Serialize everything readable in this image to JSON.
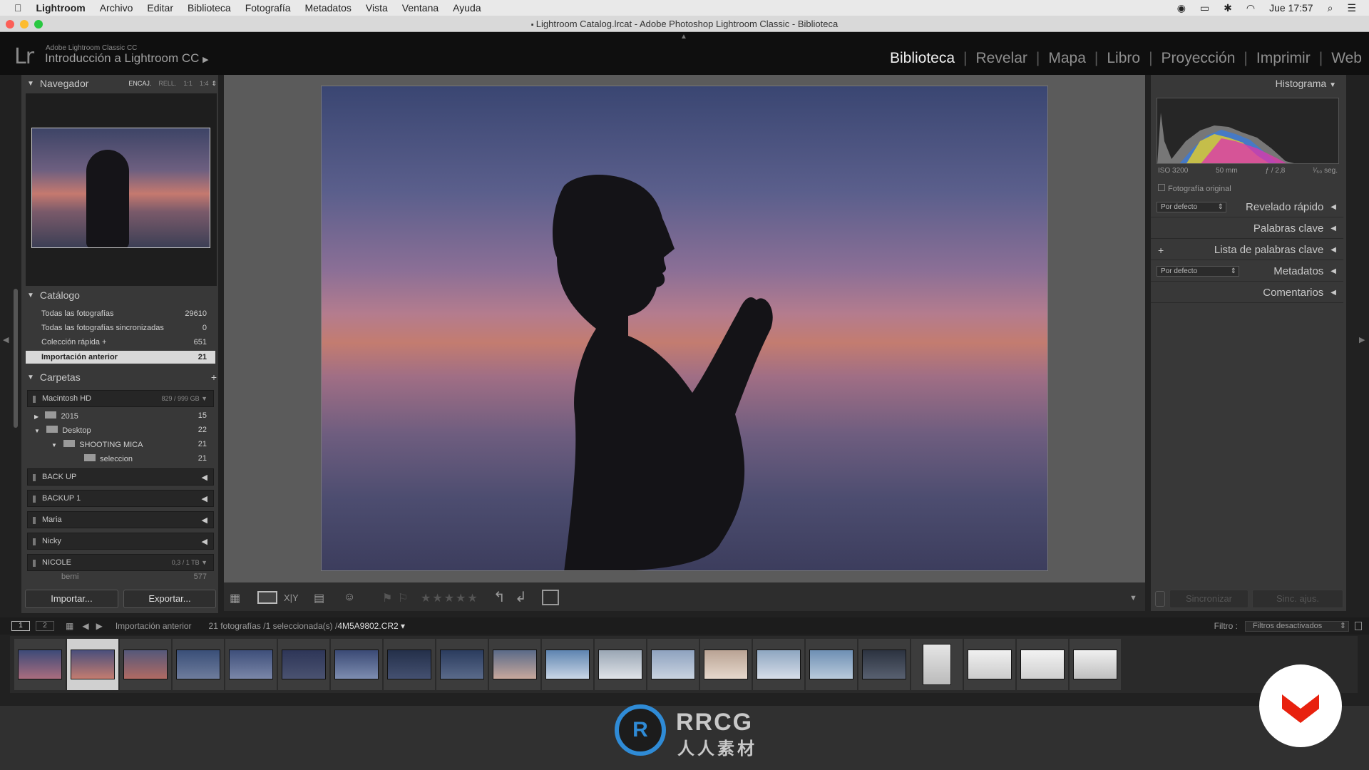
{
  "menubar": {
    "app": "Lightroom",
    "items": [
      "Archivo",
      "Editar",
      "Biblioteca",
      "Fotografía",
      "Metadatos",
      "Vista",
      "Ventana",
      "Ayuda"
    ],
    "clock": "Jue 17:57"
  },
  "window": {
    "title": "Lightroom Catalog.lrcat - Adobe Photoshop Lightroom Classic - Biblioteca"
  },
  "identity": {
    "logo": "Lr",
    "sub": "Adobe Lightroom Classic CC",
    "main": "Introducción a Lightroom CC"
  },
  "modules": [
    "Biblioteca",
    "Revelar",
    "Mapa",
    "Libro",
    "Proyección",
    "Imprimir",
    "Web"
  ],
  "navigator": {
    "title": "Navegador",
    "zoom": [
      "ENCAJ.",
      "RELL.",
      "1:1",
      "1:4"
    ]
  },
  "catalog": {
    "title": "Catálogo",
    "items": [
      {
        "label": "Todas las fotografías",
        "count": "29610"
      },
      {
        "label": "Todas las fotografías sincronizadas",
        "count": "0"
      },
      {
        "label": "Colección rápida +",
        "count": "651"
      },
      {
        "label": "Importación anterior",
        "count": "21"
      }
    ]
  },
  "folders": {
    "title": "Carpetas",
    "volume1": {
      "name": "Macintosh HD",
      "info": "829 / 999 GB"
    },
    "tree": [
      {
        "label": "2015",
        "count": "15"
      },
      {
        "label": "Desktop",
        "count": "22"
      },
      {
        "label": "SHOOTING MICA",
        "count": "21"
      },
      {
        "label": "seleccion",
        "count": "21"
      }
    ],
    "volumes": [
      "BACK UP",
      "BACKUP 1",
      "Maria",
      "Nicky"
    ],
    "nicole": {
      "name": "NICOLE",
      "info": "0,3 / 1 TB"
    },
    "last": {
      "label": "berni",
      "count": "577"
    }
  },
  "buttons": {
    "import": "Importar...",
    "export": "Exportar...",
    "sync": "Sincronizar",
    "sync_settings": "Sinc. ajus."
  },
  "histogram": {
    "title": "Histograma",
    "iso": "ISO 3200",
    "focal": "50 mm",
    "aperture": "ƒ / 2,8",
    "shutter": "¹⁄₅₀ seg.",
    "original": "Fotografía original"
  },
  "right_panels": {
    "quick": "Revelado rápido",
    "preset": "Por defecto",
    "keywords": "Palabras clave",
    "keyword_list": "Lista de palabras clave",
    "metadata": "Metadatos",
    "metadata_preset": "Por defecto",
    "comments": "Comentarios"
  },
  "filmstrip": {
    "screen1": "1",
    "screen2": "2",
    "source": "Importación anterior",
    "status": "21 fotografías /1 seleccionada(s) /",
    "file": "4M5A9802.CR2",
    "filter_label": "Filtro :",
    "filter_value": "Filtros desactivados"
  },
  "watermark": {
    "text1": "RRCG",
    "text2": "人人素材"
  },
  "colors": {
    "accent": "#f0f0f0",
    "logo_red": "#e8210e"
  }
}
